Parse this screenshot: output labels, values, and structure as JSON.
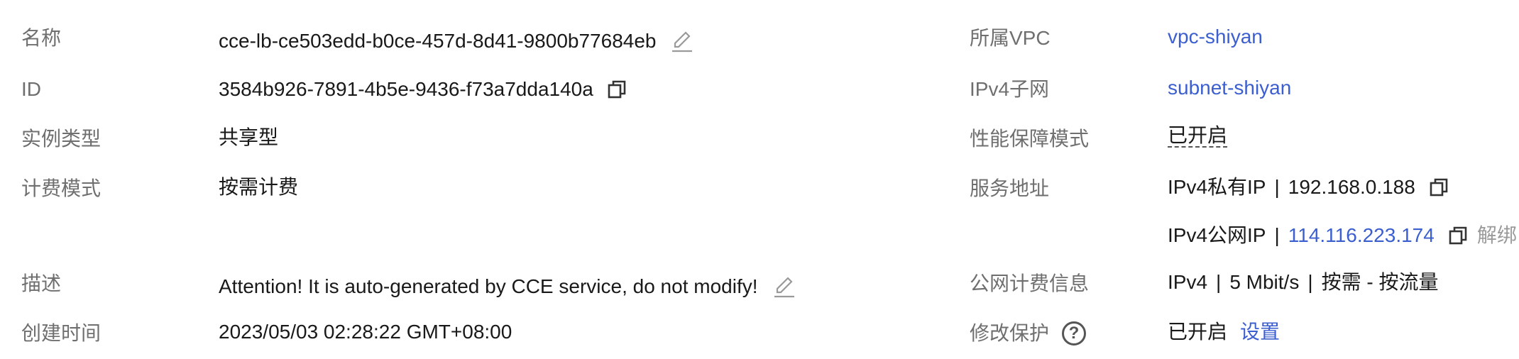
{
  "left": {
    "name": {
      "label": "名称",
      "value": "cce-lb-ce503edd-b0ce-457d-8d41-9800b77684eb"
    },
    "id": {
      "label": "ID",
      "value": "3584b926-7891-4b5e-9436-f73a7dda140a"
    },
    "instance_type": {
      "label": "实例类型",
      "value": "共享型"
    },
    "billing_mode": {
      "label": "计费模式",
      "value": "按需计费"
    },
    "description": {
      "label": "描述",
      "value": "Attention! It is auto-generated by CCE service, do not modify!"
    },
    "created_time": {
      "label": "创建时间",
      "value": "2023/05/03 02:28:22 GMT+08:00"
    }
  },
  "right": {
    "vpc": {
      "label": "所属VPC",
      "value": "vpc-shiyan"
    },
    "subnet": {
      "label": "IPv4子网",
      "value": "subnet-shiyan"
    },
    "performance_mode": {
      "label": "性能保障模式",
      "value": "已开启"
    },
    "service_address": {
      "label": "服务地址",
      "private_ip_label": "IPv4私有IP",
      "private_ip": "192.168.0.188",
      "public_ip_label": "IPv4公网IP",
      "public_ip": "114.116.223.174",
      "unbind": "解绑"
    },
    "public_billing": {
      "label": "公网计费信息",
      "ip_version": "IPv4",
      "bandwidth": "5 Mbit/s",
      "billing": "按需 - 按流量"
    },
    "modify_protection": {
      "label": "修改保护",
      "help": "?",
      "status": "已开启",
      "settings": "设置"
    }
  },
  "separator": "|",
  "colors": {
    "label": "#6f6f6f",
    "link": "#3c5fcf",
    "text": "#191919",
    "muted": "#9a9a9a"
  }
}
